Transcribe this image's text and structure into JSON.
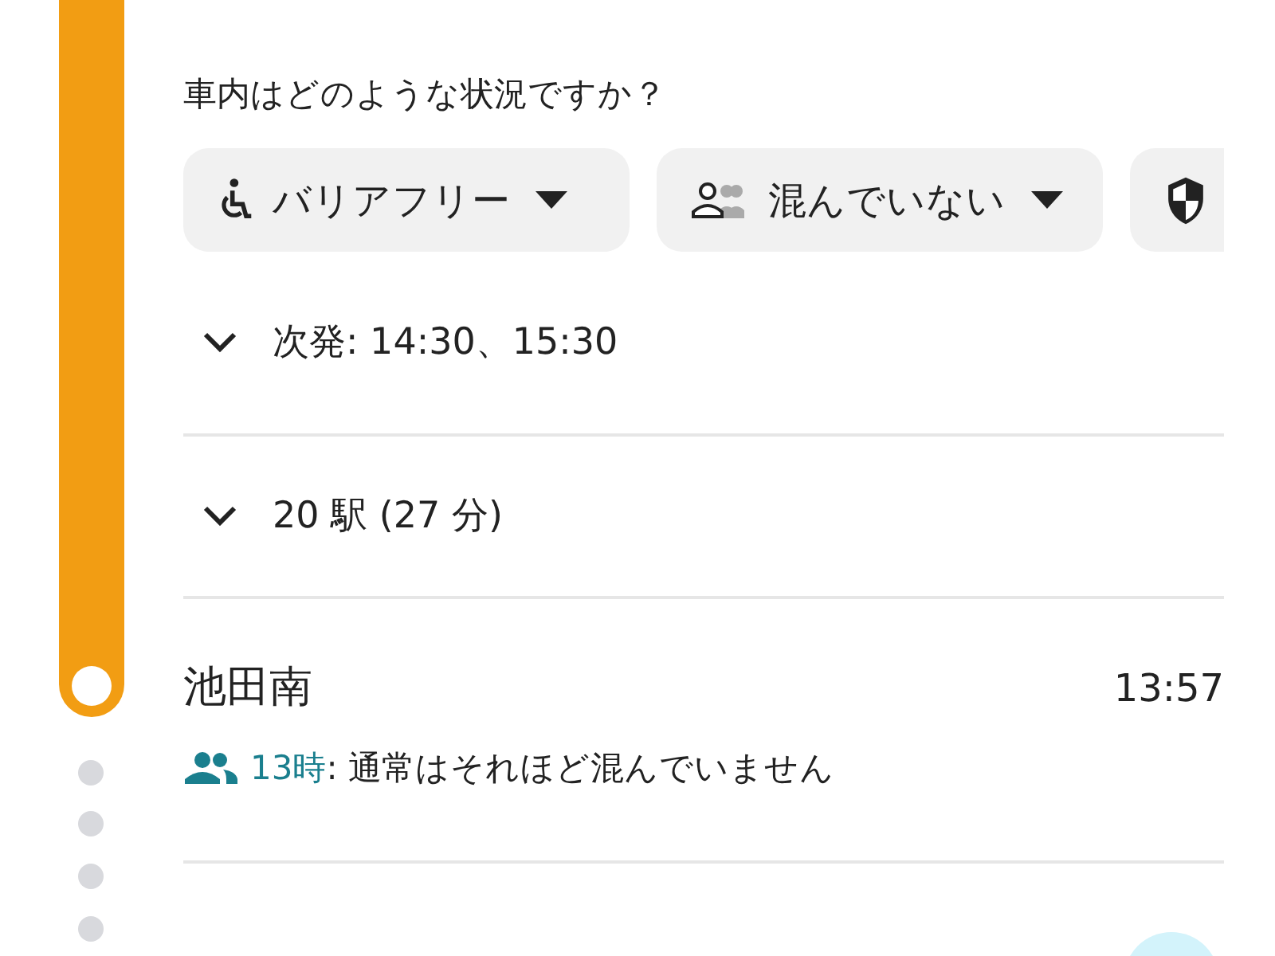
{
  "question": "車内はどのような状況ですか？",
  "filters": [
    {
      "kind": "accessibility",
      "label": "バリアフリー",
      "dropdown": true
    },
    {
      "kind": "crowding",
      "label": "混んでいない",
      "dropdown": true
    },
    {
      "kind": "safety"
    }
  ],
  "next_departures": {
    "text": "次発: 14:30、15:30",
    "expanded": false
  },
  "stops": {
    "text": "20 駅 (27 分)",
    "expanded": false
  },
  "station": {
    "name": "池田南",
    "time": "13:57",
    "crowd_hour": "13時",
    "crowd_text": ": 通常はそれほど混んでいません"
  }
}
